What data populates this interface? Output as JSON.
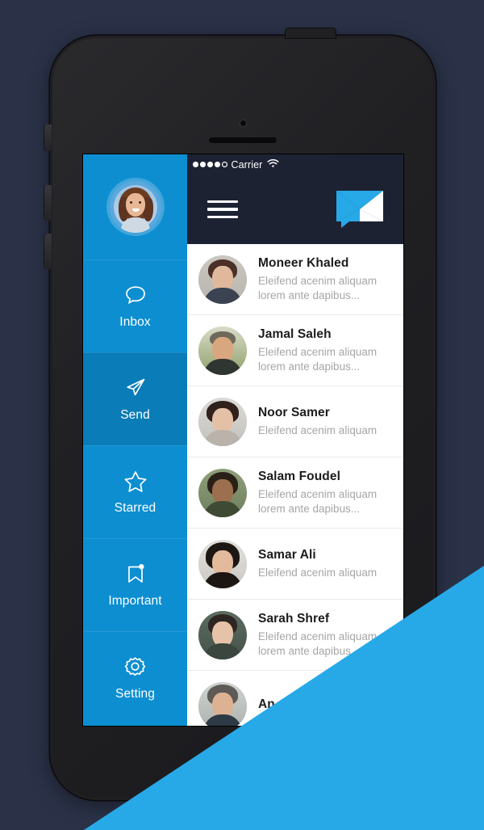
{
  "theme": {
    "background": "#2b3248",
    "accent_blue": "#0d8ed1",
    "accent_blue_active": "#0a7cb7",
    "diagonal_blue": "#27a9e8",
    "appbar_dark": "#1d2233",
    "device_body": "#1f1f22"
  },
  "statusbar": {
    "signal_filled": 4,
    "signal_total": 5,
    "carrier": "Carrier",
    "wifi_icon": "wifi-icon"
  },
  "appbar": {
    "menu_icon": "hamburger-menu-icon",
    "logo_icon": "mail-logo-icon"
  },
  "sidebar": {
    "avatar_icon": "user-avatar",
    "items": [
      {
        "label": "Inbox",
        "icon": "chat-bubble-icon",
        "active": false
      },
      {
        "label": "Send",
        "icon": "paper-plane-icon",
        "active": true
      },
      {
        "label": "Starred",
        "icon": "star-icon",
        "active": false
      },
      {
        "label": "Important",
        "icon": "bookmark-dot-icon",
        "active": false
      },
      {
        "label": "Setting",
        "icon": "gear-icon",
        "active": false
      }
    ]
  },
  "messages": [
    {
      "name": "Moneer Khaled",
      "preview": "Eleifend acenim aliquam lorem ante dapibus..."
    },
    {
      "name": "Jamal Saleh",
      "preview": "Eleifend acenim aliquam lorem ante dapibus..."
    },
    {
      "name": "Noor Samer",
      "preview": "Eleifend acenim aliquam"
    },
    {
      "name": "Salam Foudel",
      "preview": "Eleifend acenim aliquam lorem ante dapibus..."
    },
    {
      "name": "Samar Ali",
      "preview": "Eleifend acenim aliquam"
    },
    {
      "name": "Sarah Shref",
      "preview": "Eleifend acenim aliquam lorem ante dapibus..."
    },
    {
      "name": "An",
      "preview": ""
    }
  ],
  "device": {
    "camera_icon": "front-camera",
    "earpiece_icon": "earpiece-speaker",
    "power_button": "power-button",
    "silent_switch": "silent-switch",
    "volume_up": "volume-up-button",
    "volume_down": "volume-down-button"
  }
}
